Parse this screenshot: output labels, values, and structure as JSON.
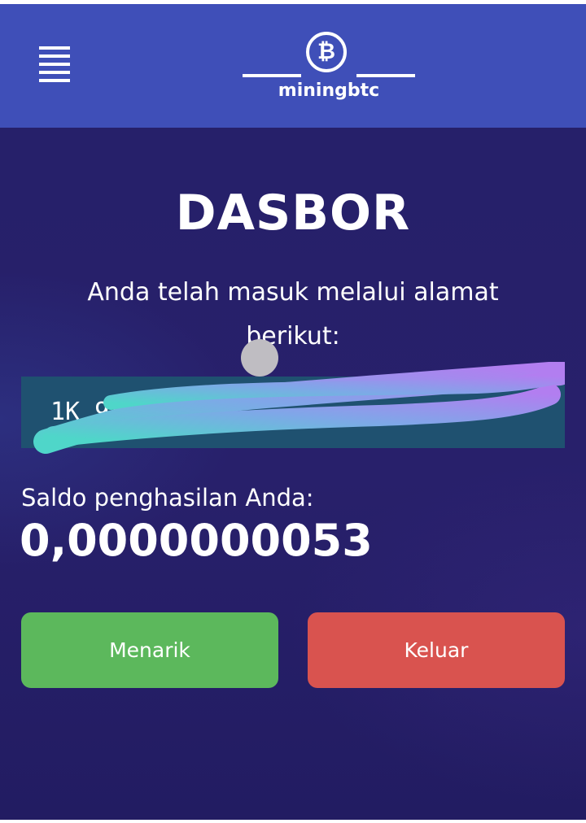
{
  "header": {
    "menu_icon": "hamburger-menu-icon",
    "logo_icon": "bitcoin-coin-icon",
    "logo_symbol": "₿",
    "logo_text": "miningbtc",
    "background_color": "#3f4fb8"
  },
  "main": {
    "title": "DASBOR",
    "subtitle": "Anda telah masuk melalui alamat berikut:",
    "address_partial": "1K        93bi                         oW..",
    "balance_label": "Saldo penghasilan Anda:",
    "balance_value": "0,0000000053",
    "background_color": "#241f68"
  },
  "actions": {
    "withdraw_label": "Menarik",
    "withdraw_color": "#5cb85c",
    "logout_label": "Keluar",
    "logout_color": "#d9534f"
  }
}
